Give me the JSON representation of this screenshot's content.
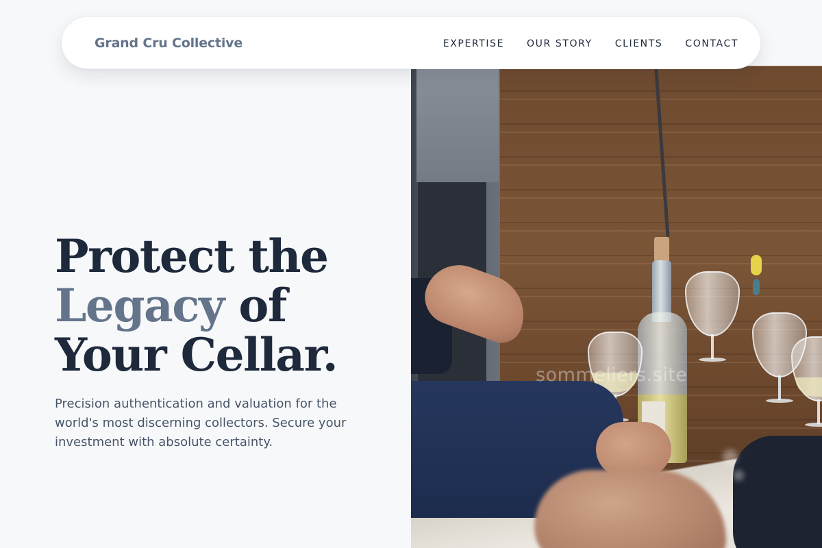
{
  "nav": {
    "brand": "Grand Cru Collective",
    "links": [
      {
        "label": "EXPERTISE"
      },
      {
        "label": "OUR STORY"
      },
      {
        "label": "CLIENTS"
      },
      {
        "label": "CONTACT"
      }
    ]
  },
  "hero": {
    "headline": {
      "line1": "Protect the",
      "line2_accent": "Legacy",
      "line2_rest": " of",
      "line3": "Your Cellar."
    },
    "subtext": "Precision authentication and valuation for the world's most discerning collectors. Secure your investment with absolute certainty.",
    "image": {
      "subject": "wine tasting at a wooden bar with bottle and glasses",
      "watermark": "sommeliers.site"
    }
  },
  "colors": {
    "page_bg": "#f7f8fa",
    "heading": "#1e293b",
    "accent_muted": "#64748b",
    "body_text": "#475569",
    "nav_bg": "#ffffff"
  }
}
